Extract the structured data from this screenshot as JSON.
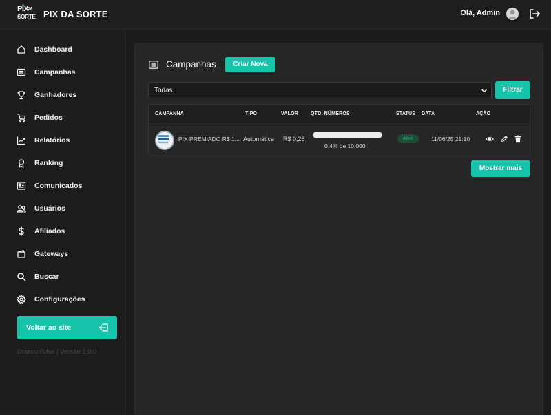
{
  "header": {
    "logo_pix": "PIX",
    "logo_da": "DA",
    "logo_sorte": "SORTE",
    "brand": "PIX DA SORTE",
    "greeting": "Olá, Admin"
  },
  "sidebar": {
    "items": [
      {
        "label": "Dashboard",
        "icon": "home-icon"
      },
      {
        "label": "Campanhas",
        "icon": "list-icon"
      },
      {
        "label": "Ganhadores",
        "icon": "trophy-icon"
      },
      {
        "label": "Pedidos",
        "icon": "cart-icon"
      },
      {
        "label": "Relatórios",
        "icon": "chart-icon"
      },
      {
        "label": "Ranking",
        "icon": "medal-icon"
      },
      {
        "label": "Comunicados",
        "icon": "newspaper-icon"
      },
      {
        "label": "Usuários",
        "icon": "users-icon"
      },
      {
        "label": "Afiliados",
        "icon": "dollar-icon"
      },
      {
        "label": "Gateways",
        "icon": "wallet-icon"
      },
      {
        "label": "Buscar",
        "icon": "search-icon"
      },
      {
        "label": "Configurações",
        "icon": "gear-icon"
      }
    ],
    "back_button": "Voltar ao site",
    "version": "Draccu Rifas | Versão 2.0.0"
  },
  "main": {
    "title": "Campanhas",
    "create_button": "Criar Nova",
    "filter": {
      "selected": "Todas",
      "button": "Filtrar"
    },
    "table": {
      "headers": [
        "CAMPANHA",
        "TIPO",
        "VALOR",
        "QTD. NÚMEROS",
        "STATUS",
        "DATA",
        "AÇÃO"
      ],
      "rows": [
        {
          "campanha": "PIX PREMIADO R$ 1...",
          "tipo": "Automática",
          "valor": "R$ 0,25",
          "progress_percent": 0.4,
          "qtd": "0.4% de 10.000",
          "status": "Ativo",
          "data": "11/06/25 21:10"
        }
      ]
    },
    "more_button": "Mostrar mais"
  },
  "colors": {
    "accent": "#17c4aa",
    "background": "#1b1b1b",
    "panel": "#262626",
    "status_active_bg": "#1d4d36",
    "status_active_text": "#2ea866"
  }
}
